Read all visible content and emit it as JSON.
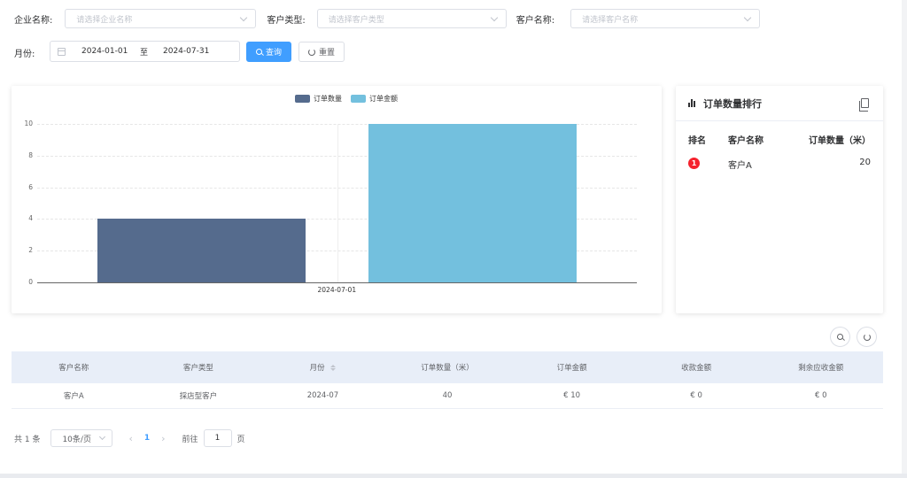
{
  "filters": {
    "company_label": "企业名称:",
    "company_placeholder": "请选择企业名称",
    "customer_type_label": "客户类型:",
    "customer_type_placeholder": "请选择客户类型",
    "customer_name_label": "客户名称:",
    "customer_name_placeholder": "请选择客户名称",
    "month_label": "月份:",
    "date_start": "2024-01-01",
    "date_sep": "至",
    "date_end": "2024-07-31",
    "query_label": "查询",
    "reset_label": "重置"
  },
  "chart_data": {
    "type": "bar",
    "categories": [
      "2024-07-01"
    ],
    "series": [
      {
        "name": "订单数量",
        "values": [
          4
        ],
        "color": "#556b8d"
      },
      {
        "name": "订单金额",
        "values": [
          10
        ],
        "color": "#73c0de"
      }
    ],
    "yticks": [
      "0",
      "2",
      "4",
      "6",
      "8",
      "10"
    ],
    "ylim": [
      0,
      10
    ],
    "legend_position": "top-center",
    "grid": true
  },
  "ranking": {
    "title": "订单数量排行",
    "col_rank": "排名",
    "col_name": "客户名称",
    "col_qty": "订单数量（米）",
    "rows": [
      {
        "rank": "1",
        "name": "客户A",
        "qty": "20"
      }
    ]
  },
  "table": {
    "headers": [
      "客户名称",
      "客户类型",
      "月份",
      "订单数量（米）",
      "订单金额",
      "收款金额",
      "剩余应收金额"
    ],
    "rows": [
      [
        "客户A",
        "採店型客户",
        "2024-07",
        "40",
        "€ 10",
        "€ 0",
        "€ 0"
      ]
    ]
  },
  "pagination": {
    "total": "共 1 条",
    "page_size": "10条/页",
    "current_page": "1",
    "goto_label": "前往",
    "goto_value": "1",
    "page_suffix": "页"
  },
  "colors": {
    "primary": "#409eff",
    "rank_badge": "#f5222d",
    "table_header_bg": "#e8eef8"
  }
}
